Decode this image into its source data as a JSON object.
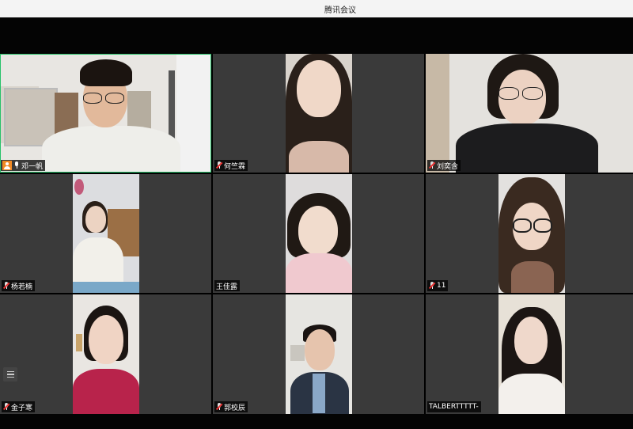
{
  "window": {
    "title": "腾讯会议"
  },
  "participants": [
    {
      "name": "邓一帆",
      "badge": "host"
    },
    {
      "name": "何竺霖",
      "badge": "mic-muted"
    },
    {
      "name": "刘奕含",
      "badge": "mic-muted"
    },
    {
      "name": "杨若楠",
      "badge": "mic-muted"
    },
    {
      "name": "王佳露",
      "badge": "none"
    },
    {
      "name": "11",
      "badge": "mic-muted"
    },
    {
      "name": "金子寒",
      "badge": "mic-muted"
    },
    {
      "name": "郭校辰",
      "badge": "mic-muted"
    },
    {
      "name": "TALBERTTTTT-",
      "badge": "none"
    }
  ],
  "colors": {
    "active_speaker_border": "#29c26a",
    "host_badge": "#f08a24"
  },
  "icons": {
    "side_panel": "list-icon"
  }
}
